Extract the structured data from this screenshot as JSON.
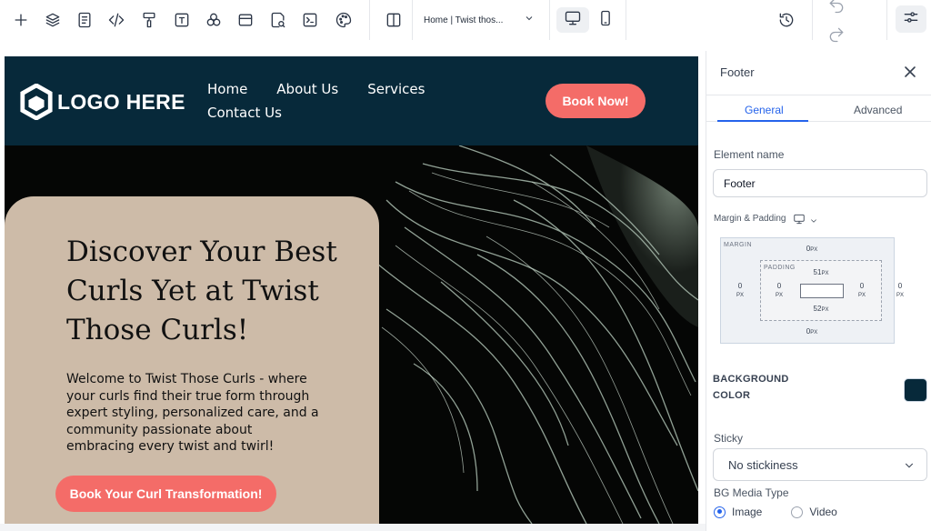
{
  "toolbar": {
    "page_selector": "Home | Twist thos...",
    "icons": [
      "plus-icon",
      "layers-icon",
      "page-icon",
      "code-icon",
      "paint-roller-icon",
      "text-icon",
      "components-icon",
      "layout-icon",
      "search-doc-icon",
      "terminal-icon",
      "palette-icon",
      "split-view-icon",
      "desktop-icon",
      "mobile-icon",
      "history-icon",
      "undo-icon",
      "redo-icon",
      "settings-sliders-icon"
    ]
  },
  "site": {
    "logo_text": "LOGO HERE",
    "nav": [
      "Home",
      "About Us",
      "Services",
      "Contact Us"
    ],
    "header_cta": "Book Now!",
    "hero_title": "Discover Your Best Curls Yet at Twist Those Curls!",
    "hero_text": "Welcome to Twist Those Curls - where your curls find their true form through expert styling, personalized care, and a community passionate about embracing every twist and twirl!",
    "hero_cta": "Book Your Curl Transformation!"
  },
  "panel": {
    "title": "Footer",
    "tabs": [
      "General",
      "Advanced"
    ],
    "element_name_label": "Element name",
    "element_name_value": "Footer",
    "margin_padding_label": "Margin & Padding",
    "margin_label": "MARGIN",
    "padding_label": "PADDING",
    "margin": {
      "top": "0",
      "right": "0",
      "bottom": "0",
      "left": "0"
    },
    "padding": {
      "top": "51",
      "right": "0",
      "bottom": "52",
      "left": "0"
    },
    "unit": "PX",
    "bg_color_label_1": "BACKGROUND",
    "bg_color_label_2": "COLOR",
    "bg_color_value": "#07293a",
    "sticky_label": "Sticky",
    "sticky_value": "No stickiness",
    "bg_media_label": "BG Media Type",
    "media_options": [
      "Image",
      "Video"
    ],
    "media_selected": "Image"
  },
  "colors": {
    "header_bg": "#07293a",
    "accent": "#f46c68",
    "card_bg": "#cdbba8",
    "tab_active": "#2563eb"
  }
}
